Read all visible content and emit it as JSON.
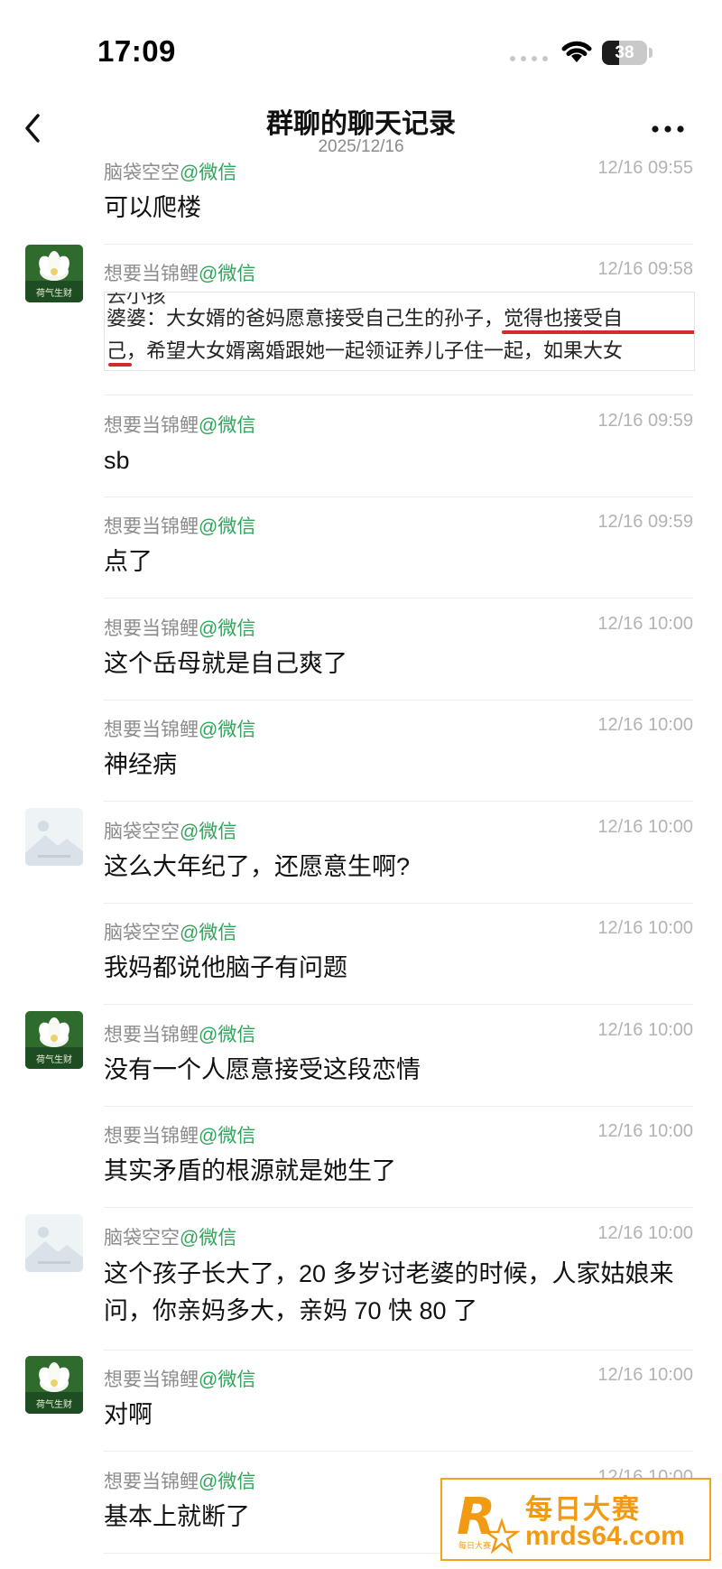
{
  "status_bar": {
    "time": "17:09",
    "battery": "38",
    "battery_level": 0.38
  },
  "nav": {
    "title": "群聊的聊天记录",
    "subtitle": "2025/12/16"
  },
  "messages": [
    {
      "sender": "脑袋空空",
      "platform": "@微信",
      "time": "12/16 09:55",
      "text": "可以爬楼",
      "avatar": "none"
    },
    {
      "sender": "想要当锦鲤",
      "platform": "@微信",
      "time": "12/16 09:58",
      "avatar": "lotus",
      "quote": {
        "cut_line": "去小孩",
        "line1": "婆婆：大女婿的爸妈愿意接受自己生的孙子，觉得也接受自",
        "line2": "己，希望大女婿离婚跟她一起领证养儿子住一起，如果大女"
      }
    },
    {
      "sender": "想要当锦鲤",
      "platform": "@微信",
      "time": "12/16 09:59",
      "text": "sb",
      "avatar": "none"
    },
    {
      "sender": "想要当锦鲤",
      "platform": "@微信",
      "time": "12/16 09:59",
      "text": "点了",
      "avatar": "none"
    },
    {
      "sender": "想要当锦鲤",
      "platform": "@微信",
      "time": "12/16 10:00",
      "text": "这个岳母就是自己爽了",
      "avatar": "none"
    },
    {
      "sender": "想要当锦鲤",
      "platform": "@微信",
      "time": "12/16 10:00",
      "text": "神经病",
      "avatar": "none"
    },
    {
      "sender": "脑袋空空",
      "platform": "@微信",
      "time": "12/16 10:00",
      "text": "这么大年纪了，还愿意生啊?",
      "avatar": "placeholder"
    },
    {
      "sender": "脑袋空空",
      "platform": "@微信",
      "time": "12/16 10:00",
      "text": "我妈都说他脑子有问题",
      "avatar": "none"
    },
    {
      "sender": "想要当锦鲤",
      "platform": "@微信",
      "time": "12/16 10:00",
      "text": "没有一个人愿意接受这段恋情",
      "avatar": "lotus"
    },
    {
      "sender": "想要当锦鲤",
      "platform": "@微信",
      "time": "12/16 10:00",
      "text": "其实矛盾的根源就是她生了",
      "avatar": "none"
    },
    {
      "sender": "脑袋空空",
      "platform": "@微信",
      "time": "12/16 10:00",
      "text": "这个孩子长大了，20 多岁讨老婆的时候，人家姑娘来问，你亲妈多大，亲妈 70 快 80 了",
      "avatar": "placeholder"
    },
    {
      "sender": "想要当锦鲤",
      "platform": "@微信",
      "time": "12/16 10:00",
      "text": "对啊",
      "avatar": "lotus"
    },
    {
      "sender": "想要当锦鲤",
      "platform": "@微信",
      "time": "12/16 10:00",
      "text": "基本上就断了",
      "avatar": "none"
    }
  ],
  "avatars": {
    "lotus_caption": "荷气生财"
  },
  "watermark": {
    "title": "每日大赛",
    "url": "mrds64.com",
    "logo_letter": "R",
    "logo_small": "每日大赛"
  },
  "colors": {
    "accent_green": "#2fa45a",
    "highlight_red": "#d12b2b",
    "watermark_orange": "#f29a14"
  }
}
